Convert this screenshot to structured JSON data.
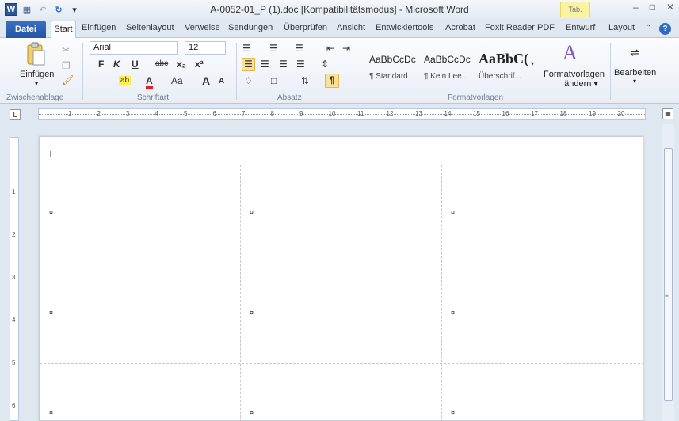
{
  "title": "A-0052-01_P (1).doc [Kompatibilitätsmodus] - Microsoft Word",
  "title_badge": "Tab.",
  "qat": {
    "word_logo": "W",
    "save": "💾",
    "undo": "↶",
    "redo": "↻",
    "customize": "▾"
  },
  "window_buttons": {
    "minimize": "–",
    "restore": "□",
    "close": "✕"
  },
  "tabs": {
    "file": "Datei",
    "items": [
      "Start",
      "Einfügen",
      "Seitenlayout",
      "Verweise",
      "Sendungen",
      "Überprüfen",
      "Ansicht",
      "Entwicklertools",
      "Acrobat",
      "Foxit Reader PDF"
    ],
    "right": [
      "Entwurf",
      "Layout"
    ]
  },
  "ribbon": {
    "clipboard": {
      "paste": "Einfügen",
      "label": "Zwischenablage"
    },
    "font": {
      "name": "Arial",
      "size": "12",
      "bold": "F",
      "italic": "K",
      "underline": "U",
      "strike": "abc",
      "subscript": "x₂",
      "superscript": "x²",
      "grow": "A",
      "shrink": "A",
      "case": "Aa",
      "label": "Schriftart"
    },
    "paragraph": {
      "label": "Absatz",
      "pilcrow": "¶"
    },
    "styles": {
      "label": "Formatvorlagen",
      "tiles": [
        {
          "preview": "AaBbCcDc",
          "name": "¶ Standard"
        },
        {
          "preview": "AaBbCcDc",
          "name": "¶ Kein Lee..."
        },
        {
          "preview": "AaBbC(",
          "name": "Überschrif..."
        }
      ],
      "change": "Formatvorlagenändern",
      "change_line1": "Formatvorlagen",
      "change_line2": "ändern ▾"
    },
    "editing": {
      "label": "Bearbeiten"
    }
  },
  "ruler": {
    "corner": "L",
    "h_numbers": [
      "1",
      "2",
      "3",
      "4",
      "5",
      "6",
      "7",
      "8",
      "9",
      "10",
      "11",
      "12",
      "13",
      "14",
      "15",
      "16",
      "17",
      "18",
      "19",
      "20"
    ],
    "v_numbers": [
      "1",
      "2",
      "3",
      "4",
      "5",
      "6"
    ]
  },
  "document": {
    "cell_mark": "¤"
  }
}
